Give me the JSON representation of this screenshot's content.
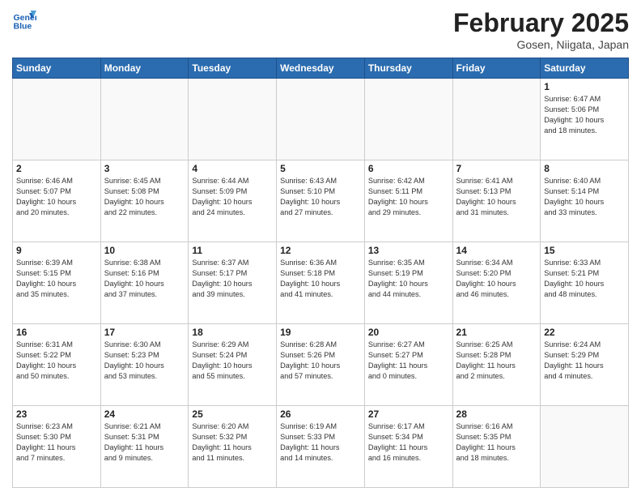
{
  "header": {
    "logo_line1": "General",
    "logo_line2": "Blue",
    "month_title": "February 2025",
    "location": "Gosen, Niigata, Japan"
  },
  "weekdays": [
    "Sunday",
    "Monday",
    "Tuesday",
    "Wednesday",
    "Thursday",
    "Friday",
    "Saturday"
  ],
  "weeks": [
    [
      {
        "day": "",
        "info": ""
      },
      {
        "day": "",
        "info": ""
      },
      {
        "day": "",
        "info": ""
      },
      {
        "day": "",
        "info": ""
      },
      {
        "day": "",
        "info": ""
      },
      {
        "day": "",
        "info": ""
      },
      {
        "day": "1",
        "info": "Sunrise: 6:47 AM\nSunset: 5:06 PM\nDaylight: 10 hours\nand 18 minutes."
      }
    ],
    [
      {
        "day": "2",
        "info": "Sunrise: 6:46 AM\nSunset: 5:07 PM\nDaylight: 10 hours\nand 20 minutes."
      },
      {
        "day": "3",
        "info": "Sunrise: 6:45 AM\nSunset: 5:08 PM\nDaylight: 10 hours\nand 22 minutes."
      },
      {
        "day": "4",
        "info": "Sunrise: 6:44 AM\nSunset: 5:09 PM\nDaylight: 10 hours\nand 24 minutes."
      },
      {
        "day": "5",
        "info": "Sunrise: 6:43 AM\nSunset: 5:10 PM\nDaylight: 10 hours\nand 27 minutes."
      },
      {
        "day": "6",
        "info": "Sunrise: 6:42 AM\nSunset: 5:11 PM\nDaylight: 10 hours\nand 29 minutes."
      },
      {
        "day": "7",
        "info": "Sunrise: 6:41 AM\nSunset: 5:13 PM\nDaylight: 10 hours\nand 31 minutes."
      },
      {
        "day": "8",
        "info": "Sunrise: 6:40 AM\nSunset: 5:14 PM\nDaylight: 10 hours\nand 33 minutes."
      }
    ],
    [
      {
        "day": "9",
        "info": "Sunrise: 6:39 AM\nSunset: 5:15 PM\nDaylight: 10 hours\nand 35 minutes."
      },
      {
        "day": "10",
        "info": "Sunrise: 6:38 AM\nSunset: 5:16 PM\nDaylight: 10 hours\nand 37 minutes."
      },
      {
        "day": "11",
        "info": "Sunrise: 6:37 AM\nSunset: 5:17 PM\nDaylight: 10 hours\nand 39 minutes."
      },
      {
        "day": "12",
        "info": "Sunrise: 6:36 AM\nSunset: 5:18 PM\nDaylight: 10 hours\nand 41 minutes."
      },
      {
        "day": "13",
        "info": "Sunrise: 6:35 AM\nSunset: 5:19 PM\nDaylight: 10 hours\nand 44 minutes."
      },
      {
        "day": "14",
        "info": "Sunrise: 6:34 AM\nSunset: 5:20 PM\nDaylight: 10 hours\nand 46 minutes."
      },
      {
        "day": "15",
        "info": "Sunrise: 6:33 AM\nSunset: 5:21 PM\nDaylight: 10 hours\nand 48 minutes."
      }
    ],
    [
      {
        "day": "16",
        "info": "Sunrise: 6:31 AM\nSunset: 5:22 PM\nDaylight: 10 hours\nand 50 minutes."
      },
      {
        "day": "17",
        "info": "Sunrise: 6:30 AM\nSunset: 5:23 PM\nDaylight: 10 hours\nand 53 minutes."
      },
      {
        "day": "18",
        "info": "Sunrise: 6:29 AM\nSunset: 5:24 PM\nDaylight: 10 hours\nand 55 minutes."
      },
      {
        "day": "19",
        "info": "Sunrise: 6:28 AM\nSunset: 5:26 PM\nDaylight: 10 hours\nand 57 minutes."
      },
      {
        "day": "20",
        "info": "Sunrise: 6:27 AM\nSunset: 5:27 PM\nDaylight: 11 hours\nand 0 minutes."
      },
      {
        "day": "21",
        "info": "Sunrise: 6:25 AM\nSunset: 5:28 PM\nDaylight: 11 hours\nand 2 minutes."
      },
      {
        "day": "22",
        "info": "Sunrise: 6:24 AM\nSunset: 5:29 PM\nDaylight: 11 hours\nand 4 minutes."
      }
    ],
    [
      {
        "day": "23",
        "info": "Sunrise: 6:23 AM\nSunset: 5:30 PM\nDaylight: 11 hours\nand 7 minutes."
      },
      {
        "day": "24",
        "info": "Sunrise: 6:21 AM\nSunset: 5:31 PM\nDaylight: 11 hours\nand 9 minutes."
      },
      {
        "day": "25",
        "info": "Sunrise: 6:20 AM\nSunset: 5:32 PM\nDaylight: 11 hours\nand 11 minutes."
      },
      {
        "day": "26",
        "info": "Sunrise: 6:19 AM\nSunset: 5:33 PM\nDaylight: 11 hours\nand 14 minutes."
      },
      {
        "day": "27",
        "info": "Sunrise: 6:17 AM\nSunset: 5:34 PM\nDaylight: 11 hours\nand 16 minutes."
      },
      {
        "day": "28",
        "info": "Sunrise: 6:16 AM\nSunset: 5:35 PM\nDaylight: 11 hours\nand 18 minutes."
      },
      {
        "day": "",
        "info": ""
      }
    ]
  ]
}
